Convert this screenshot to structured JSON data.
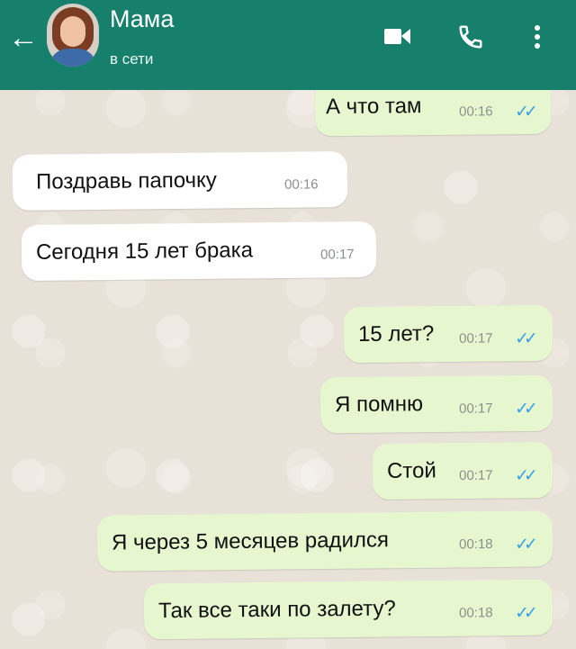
{
  "header": {
    "back_icon": "arrow-left-icon",
    "title": "Мама",
    "status": "в сети",
    "video_icon": "video-camera-icon",
    "call_icon": "phone-icon",
    "menu_icon": "more-vert-icon",
    "color": "#16806c"
  },
  "messages": [
    {
      "direction": "out",
      "text": "А что там",
      "time": "00:16",
      "ticks": "✓✓"
    },
    {
      "direction": "in",
      "text": "Поздравь папочку",
      "time": "00:16"
    },
    {
      "direction": "in",
      "text": "Сегодня 15 лет брака",
      "time": "00:17"
    },
    {
      "direction": "out",
      "text": "15 лет?",
      "time": "00:17",
      "ticks": "✓✓"
    },
    {
      "direction": "out",
      "text": "Я помню",
      "time": "00:17",
      "ticks": "✓✓"
    },
    {
      "direction": "out",
      "text": "Стой",
      "time": "00:17",
      "ticks": "✓✓"
    },
    {
      "direction": "out",
      "text": "Я через 5 месяцев радился",
      "time": "00:18",
      "ticks": "✓✓"
    },
    {
      "direction": "out",
      "text": "Так все таки по залету?",
      "time": "00:18",
      "ticks": "✓✓"
    }
  ],
  "colors": {
    "outgoing_bubble": "#e6f7d0",
    "incoming_bubble": "#ffffff",
    "read_ticks": "#3aa0e6"
  }
}
